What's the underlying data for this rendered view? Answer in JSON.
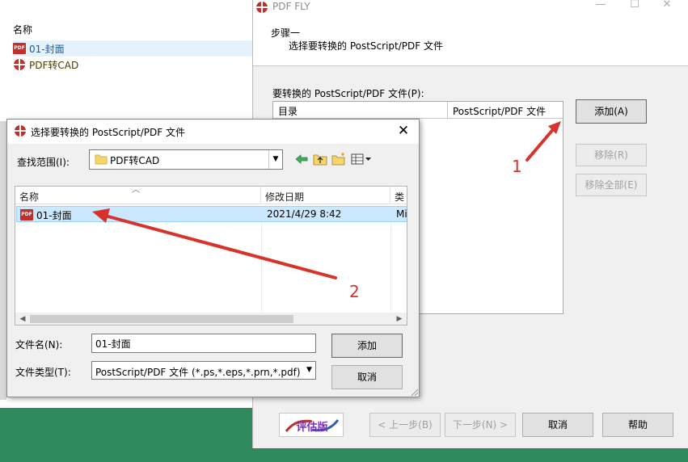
{
  "explorer": {
    "column_header": "名称",
    "rows": [
      {
        "label": "01-封面",
        "icon": "pdf-file-icon"
      },
      {
        "label": "PDF转CAD",
        "icon": "pdffly-app-icon"
      }
    ]
  },
  "wizard": {
    "title": "PDF FLY",
    "step_title": "步骤一",
    "step_description": "选择要转换的 PostScript/PDF 文件",
    "list_label": "要转换的 PostScript/PDF 文件(P):",
    "list_columns": [
      "目录",
      "PostScript/PDF 文件"
    ],
    "buttons": {
      "add": "添加(A)",
      "remove": "移除(R)",
      "remove_all": "移除全部(E)",
      "back": "< 上一步(B)",
      "next": "下一步(N) >",
      "cancel": "取消",
      "help": "帮助"
    },
    "logo_text": "评估版"
  },
  "dialog": {
    "title": "选择要转换的 PostScript/PDF 文件",
    "look_in_label": "查找范围(I):",
    "look_in_value": "PDF转CAD",
    "columns": [
      "名称",
      "修改日期",
      "类型"
    ],
    "files": [
      {
        "name": "01-封面",
        "modified": "2021/4/29 8:42",
        "type": "Mi"
      }
    ],
    "filename_label": "文件名(N):",
    "filename_value": "01-封面",
    "filetype_label": "文件类型(T):",
    "filetype_value": "PostScript/PDF 文件  (*.ps,*.eps,*.prn,*.pdf)",
    "buttons": {
      "open": "添加",
      "cancel": "取消"
    }
  },
  "annotations": {
    "label_1": "1",
    "label_2": "2",
    "color": "#d8322a"
  },
  "colors": {
    "selection": "#cce8ff",
    "taskbar_green": "#2e8a5c",
    "pdf_icon": "#c0302a"
  }
}
